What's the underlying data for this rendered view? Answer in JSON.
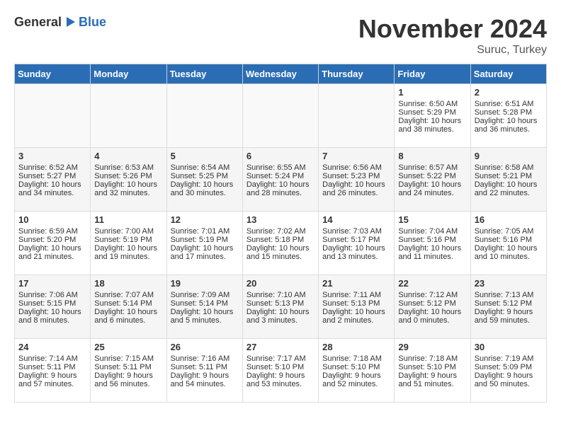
{
  "header": {
    "logo_general": "General",
    "logo_blue": "Blue",
    "month_title": "November 2024",
    "location": "Suruc, Turkey"
  },
  "days_of_week": [
    "Sunday",
    "Monday",
    "Tuesday",
    "Wednesday",
    "Thursday",
    "Friday",
    "Saturday"
  ],
  "weeks": [
    [
      {
        "day": "",
        "info": ""
      },
      {
        "day": "",
        "info": ""
      },
      {
        "day": "",
        "info": ""
      },
      {
        "day": "",
        "info": ""
      },
      {
        "day": "",
        "info": ""
      },
      {
        "day": "1",
        "info": "Sunrise: 6:50 AM\nSunset: 5:29 PM\nDaylight: 10 hours and 38 minutes."
      },
      {
        "day": "2",
        "info": "Sunrise: 6:51 AM\nSunset: 5:28 PM\nDaylight: 10 hours and 36 minutes."
      }
    ],
    [
      {
        "day": "3",
        "info": "Sunrise: 6:52 AM\nSunset: 5:27 PM\nDaylight: 10 hours and 34 minutes."
      },
      {
        "day": "4",
        "info": "Sunrise: 6:53 AM\nSunset: 5:26 PM\nDaylight: 10 hours and 32 minutes."
      },
      {
        "day": "5",
        "info": "Sunrise: 6:54 AM\nSunset: 5:25 PM\nDaylight: 10 hours and 30 minutes."
      },
      {
        "day": "6",
        "info": "Sunrise: 6:55 AM\nSunset: 5:24 PM\nDaylight: 10 hours and 28 minutes."
      },
      {
        "day": "7",
        "info": "Sunrise: 6:56 AM\nSunset: 5:23 PM\nDaylight: 10 hours and 26 minutes."
      },
      {
        "day": "8",
        "info": "Sunrise: 6:57 AM\nSunset: 5:22 PM\nDaylight: 10 hours and 24 minutes."
      },
      {
        "day": "9",
        "info": "Sunrise: 6:58 AM\nSunset: 5:21 PM\nDaylight: 10 hours and 22 minutes."
      }
    ],
    [
      {
        "day": "10",
        "info": "Sunrise: 6:59 AM\nSunset: 5:20 PM\nDaylight: 10 hours and 21 minutes."
      },
      {
        "day": "11",
        "info": "Sunrise: 7:00 AM\nSunset: 5:19 PM\nDaylight: 10 hours and 19 minutes."
      },
      {
        "day": "12",
        "info": "Sunrise: 7:01 AM\nSunset: 5:19 PM\nDaylight: 10 hours and 17 minutes."
      },
      {
        "day": "13",
        "info": "Sunrise: 7:02 AM\nSunset: 5:18 PM\nDaylight: 10 hours and 15 minutes."
      },
      {
        "day": "14",
        "info": "Sunrise: 7:03 AM\nSunset: 5:17 PM\nDaylight: 10 hours and 13 minutes."
      },
      {
        "day": "15",
        "info": "Sunrise: 7:04 AM\nSunset: 5:16 PM\nDaylight: 10 hours and 11 minutes."
      },
      {
        "day": "16",
        "info": "Sunrise: 7:05 AM\nSunset: 5:16 PM\nDaylight: 10 hours and 10 minutes."
      }
    ],
    [
      {
        "day": "17",
        "info": "Sunrise: 7:06 AM\nSunset: 5:15 PM\nDaylight: 10 hours and 8 minutes."
      },
      {
        "day": "18",
        "info": "Sunrise: 7:07 AM\nSunset: 5:14 PM\nDaylight: 10 hours and 6 minutes."
      },
      {
        "day": "19",
        "info": "Sunrise: 7:09 AM\nSunset: 5:14 PM\nDaylight: 10 hours and 5 minutes."
      },
      {
        "day": "20",
        "info": "Sunrise: 7:10 AM\nSunset: 5:13 PM\nDaylight: 10 hours and 3 minutes."
      },
      {
        "day": "21",
        "info": "Sunrise: 7:11 AM\nSunset: 5:13 PM\nDaylight: 10 hours and 2 minutes."
      },
      {
        "day": "22",
        "info": "Sunrise: 7:12 AM\nSunset: 5:12 PM\nDaylight: 10 hours and 0 minutes."
      },
      {
        "day": "23",
        "info": "Sunrise: 7:13 AM\nSunset: 5:12 PM\nDaylight: 9 hours and 59 minutes."
      }
    ],
    [
      {
        "day": "24",
        "info": "Sunrise: 7:14 AM\nSunset: 5:11 PM\nDaylight: 9 hours and 57 minutes."
      },
      {
        "day": "25",
        "info": "Sunrise: 7:15 AM\nSunset: 5:11 PM\nDaylight: 9 hours and 56 minutes."
      },
      {
        "day": "26",
        "info": "Sunrise: 7:16 AM\nSunset: 5:11 PM\nDaylight: 9 hours and 54 minutes."
      },
      {
        "day": "27",
        "info": "Sunrise: 7:17 AM\nSunset: 5:10 PM\nDaylight: 9 hours and 53 minutes."
      },
      {
        "day": "28",
        "info": "Sunrise: 7:18 AM\nSunset: 5:10 PM\nDaylight: 9 hours and 52 minutes."
      },
      {
        "day": "29",
        "info": "Sunrise: 7:18 AM\nSunset: 5:10 PM\nDaylight: 9 hours and 51 minutes."
      },
      {
        "day": "30",
        "info": "Sunrise: 7:19 AM\nSunset: 5:09 PM\nDaylight: 9 hours and 50 minutes."
      }
    ]
  ]
}
